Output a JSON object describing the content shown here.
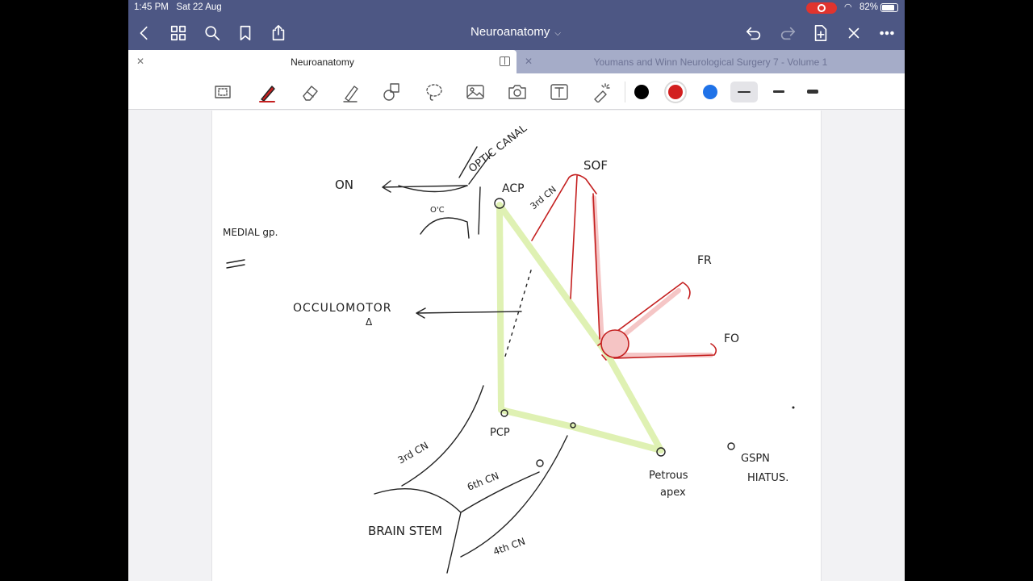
{
  "status_bar": {
    "time": "1:45 PM",
    "date": "Sat 22 Aug",
    "battery": "82%"
  },
  "nav": {
    "title": "Neuroanatomy",
    "icons": [
      "back-icon",
      "grid-icon",
      "search-icon",
      "bookmark-icon",
      "share-icon",
      "undo-icon",
      "redo-icon",
      "add-page-icon",
      "close-icon",
      "more-icon"
    ]
  },
  "tabs": [
    {
      "label": "Neuroanatomy",
      "active": true
    },
    {
      "label": "Youmans and Winn Neurological Surgery 7 - Volume 1",
      "active": false
    }
  ],
  "toolbar": {
    "tools": [
      "zoom-icon",
      "pen-icon",
      "eraser-icon",
      "highlighter-icon",
      "shapes-icon",
      "lasso-icon",
      "image-icon",
      "camera-icon",
      "text-icon",
      "laser-pointer-icon"
    ],
    "colors": [
      "#000000",
      "#d21f1f",
      "#1f72e8"
    ],
    "selected_color": "#d21f1f",
    "stroke_widths": [
      "thin",
      "medium",
      "thick"
    ],
    "selected_stroke": "thin"
  },
  "note": {
    "labels": {
      "optic_canal": "OPTIC CANAL",
      "on": "ON",
      "oc": "O'C",
      "acp": "ACP",
      "third_cn_upper": "3rd CN",
      "sof": "SOF",
      "medial_gp": "MEDIAL gp.",
      "fr": "FR",
      "fo": "FO",
      "occulomotor": "OCCULOMOTOR",
      "delta": "Δ",
      "third_cn_lower": "3rd CN",
      "pcp": "PCP",
      "sixth_cn": "6th CN",
      "fourth_cn": "4th CN",
      "brain_stem": "BRAIN STEM",
      "petrous_apex_1": "Petrous",
      "petrous_apex_2": "apex",
      "gspn": "GSPN",
      "hiatus": "HIATUS."
    }
  }
}
